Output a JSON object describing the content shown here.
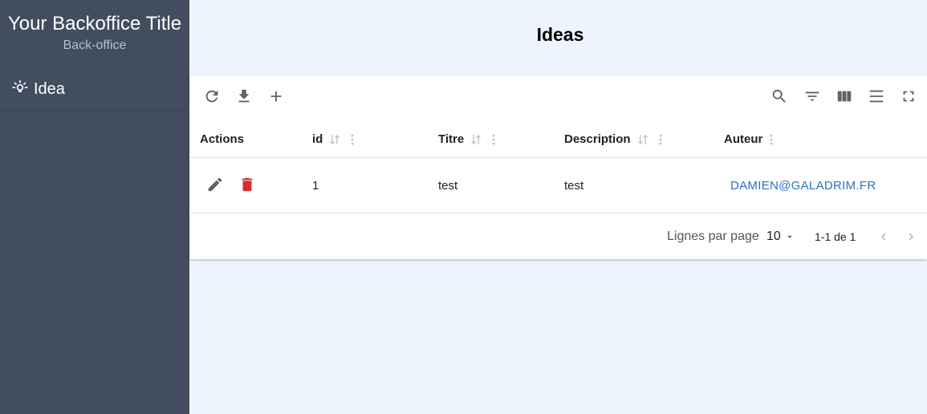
{
  "sidebar": {
    "title": "Your Backoffice Title",
    "subtitle": "Back-office",
    "items": [
      {
        "label": "Idea",
        "icon": "lightbulb-icon"
      }
    ]
  },
  "main": {
    "title": "Ideas"
  },
  "toolbar": {
    "left_icons": [
      "refresh-icon",
      "download-icon",
      "add-icon"
    ],
    "right_icons": [
      "search-icon",
      "filter-icon",
      "view-columns-icon",
      "density-icon",
      "fullscreen-icon"
    ]
  },
  "table": {
    "columns": [
      {
        "label": "Actions"
      },
      {
        "label": "id"
      },
      {
        "label": "Titre"
      },
      {
        "label": "Description"
      },
      {
        "label": "Auteur"
      }
    ],
    "rows": [
      {
        "id": "1",
        "titre": "test",
        "description": "test",
        "auteur": "DAMIEN@GALADRIM.FR"
      }
    ]
  },
  "pagination": {
    "rows_per_page_label": "Lignes par page",
    "rows_per_page": "10",
    "range": "1-1 de 1"
  },
  "colors": {
    "sidebar_bg": "#424e5f",
    "page_bg": "#eef4fd",
    "delete": "#d32f2f",
    "link": "#2a72c4"
  }
}
